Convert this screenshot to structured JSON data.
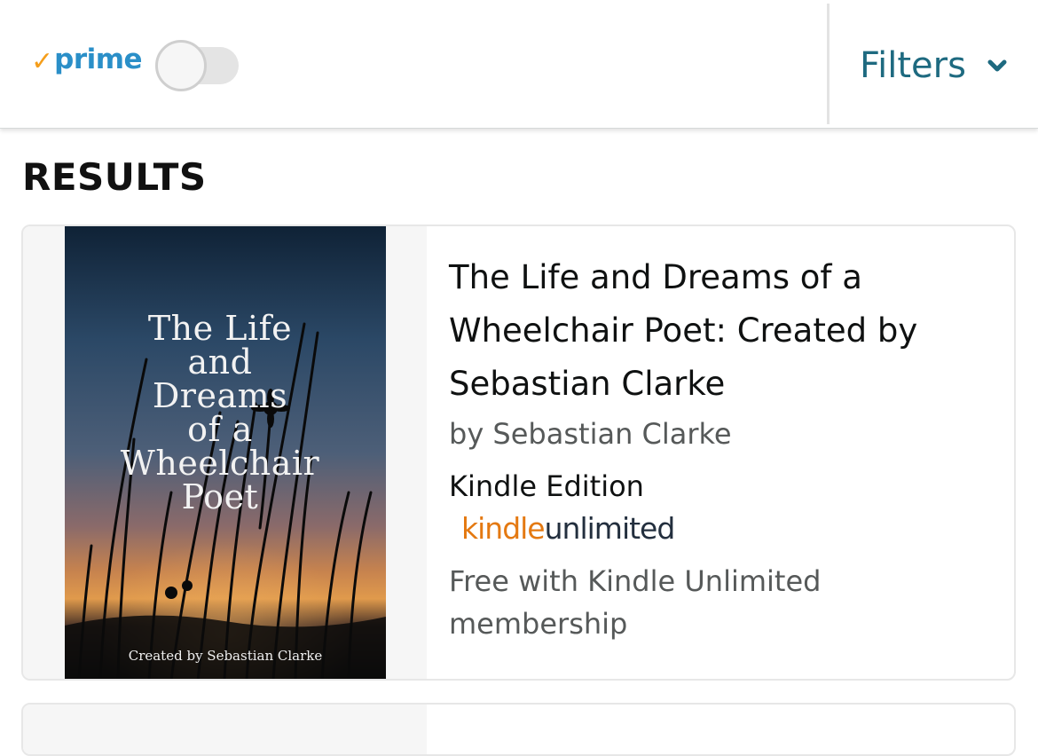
{
  "topbar": {
    "prime_check": "✓",
    "prime_label": "prime",
    "prime_toggle_on": false,
    "filters_label": "Filters"
  },
  "results": {
    "heading": "RESULTS",
    "items": [
      {
        "cover": {
          "title": "The Life\nand\nDreams\nof a\nWheelchair\nPoet",
          "byline": "Created by Sebastian Clarke"
        },
        "title": "The Life and Dreams of a Wheelchair Poet: Created by Sebastian Clarke",
        "author": "by Sebastian Clarke",
        "format": "Kindle Edition",
        "ku_kindle": "kindle",
        "ku_unlimited": "unlimited",
        "ku_note": "Free with Kindle Unlimited membership"
      }
    ]
  },
  "colors": {
    "prime_check": "#f59e1b",
    "prime_blue": "#2a8fc8",
    "filters_teal": "#1e6a80",
    "ku_orange": "#e47911",
    "text_secondary": "#565959"
  },
  "icons": {
    "filters": "chevron-down-icon"
  }
}
